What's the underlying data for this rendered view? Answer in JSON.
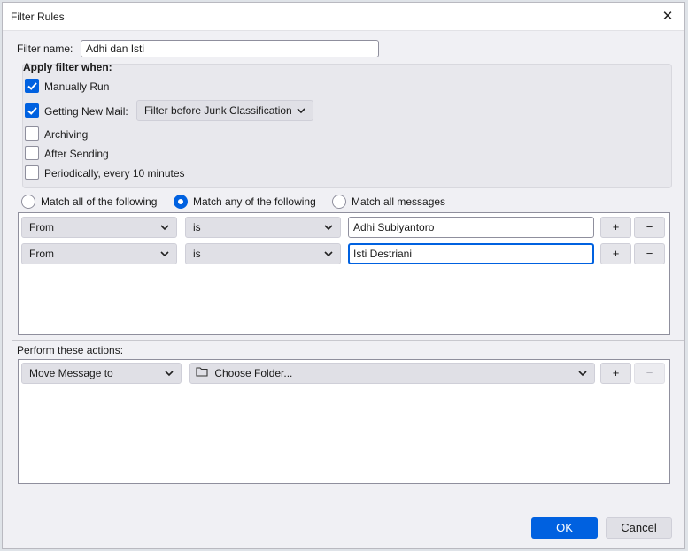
{
  "dialog": {
    "title": "Filter Rules",
    "close_label": "✕"
  },
  "filter_name": {
    "label": "Filter name:",
    "value": "Adhi dan Isti"
  },
  "apply_when": {
    "heading": "Apply filter when:",
    "manually_run": {
      "label": "Manually Run",
      "checked": true
    },
    "getting_new_mail": {
      "label": "Getting New Mail:",
      "checked": true,
      "option": "Filter before Junk Classification"
    },
    "archiving": {
      "label": "Archiving",
      "checked": false
    },
    "after_sending": {
      "label": "After Sending",
      "checked": false
    },
    "periodically": {
      "label": "Periodically, every 10 minutes",
      "checked": false
    }
  },
  "match": {
    "all": "Match all of the following",
    "any": "Match any of the following",
    "messages": "Match all messages",
    "selected": "any"
  },
  "rules": [
    {
      "field": "From",
      "operator": "is",
      "value": "Adhi Subiyantoro"
    },
    {
      "field": "From",
      "operator": "is",
      "value": "Isti Destriani"
    }
  ],
  "actions": {
    "label": "Perform these actions:",
    "items": [
      {
        "action": "Move Message to",
        "target": "Choose Folder..."
      }
    ]
  },
  "buttons": {
    "add": "+",
    "remove": "−",
    "ok": "OK",
    "cancel": "Cancel"
  },
  "colors": {
    "accent": "#0061e0"
  }
}
